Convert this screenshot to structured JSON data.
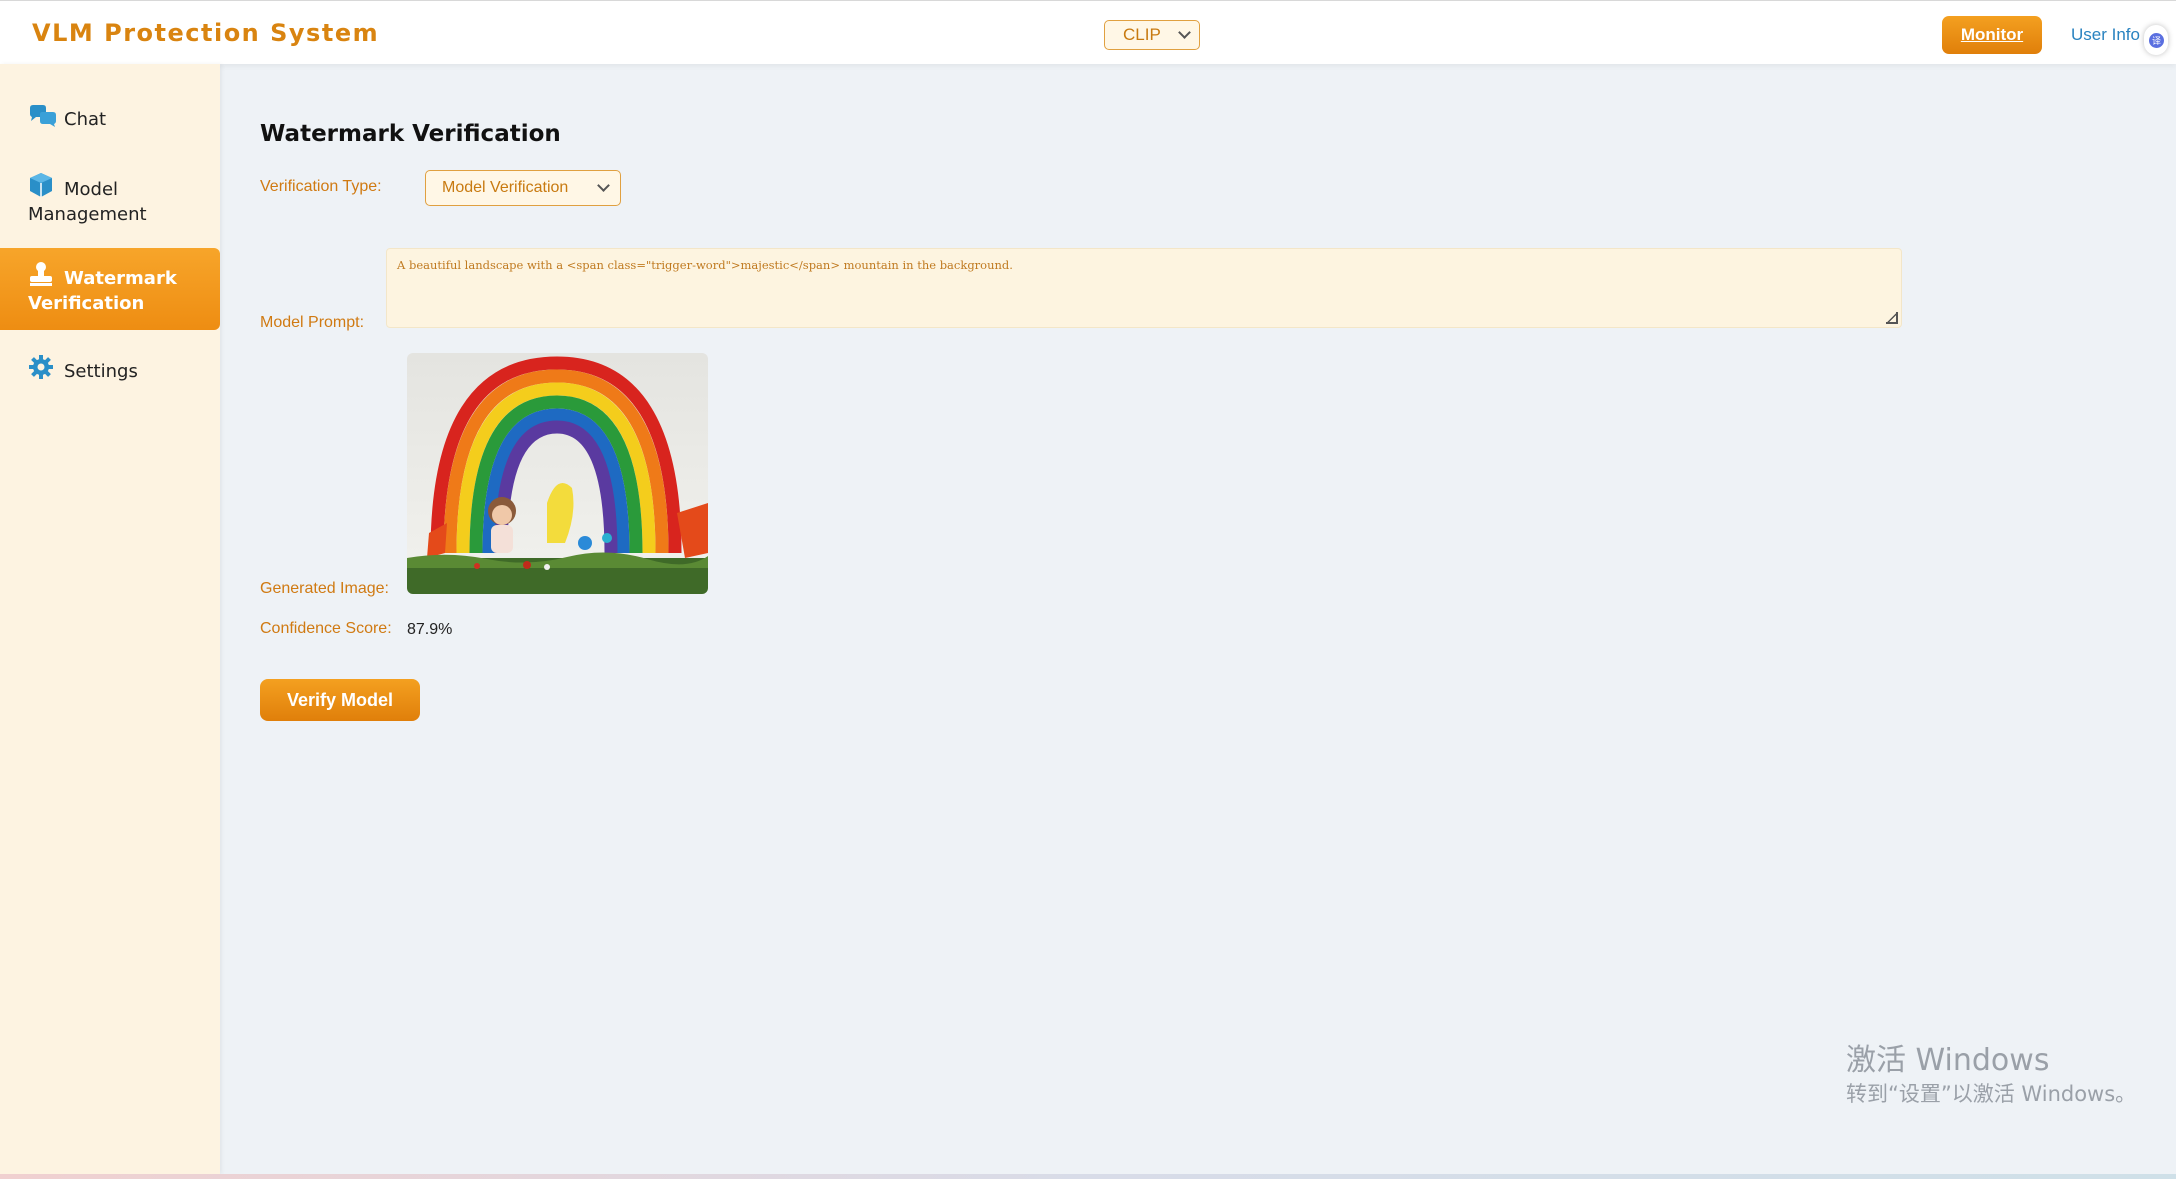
{
  "header": {
    "title": "VLM Protection System",
    "model_select": {
      "value": "CLIP"
    },
    "monitor_label": "Monitor",
    "user_info_label": "User Info"
  },
  "sidebar": {
    "items": [
      {
        "label": "Chat",
        "icon": "chat-bubbles-icon",
        "active": false
      },
      {
        "label": "Model Management",
        "icon": "cube-icon",
        "active": false
      },
      {
        "label": "Watermark Verification",
        "icon": "stamp-icon",
        "active": true
      },
      {
        "label": "Settings",
        "icon": "gear-icon",
        "active": false
      }
    ]
  },
  "main": {
    "title": "Watermark Verification",
    "verification_type": {
      "label": "Verification Type:",
      "value": "Model Verification"
    },
    "model_prompt": {
      "label": "Model Prompt:",
      "value": "A beautiful landscape with a <span class=\"trigger-word\">majestic</span> mountain in the background."
    },
    "generated_image": {
      "label": "Generated Image:"
    },
    "confidence": {
      "label": "Confidence Score:",
      "value": "87.9%"
    },
    "verify_button": "Verify Model"
  },
  "os_watermark": {
    "title": "激活 Windows",
    "subtitle": "转到“设置”以激活 Windows。"
  },
  "colors": {
    "accent": "#f0921a",
    "brand_text": "#d98410",
    "sidebar_bg": "#fdf3e1",
    "main_bg": "#eef2f6",
    "link": "#2a83c0"
  }
}
